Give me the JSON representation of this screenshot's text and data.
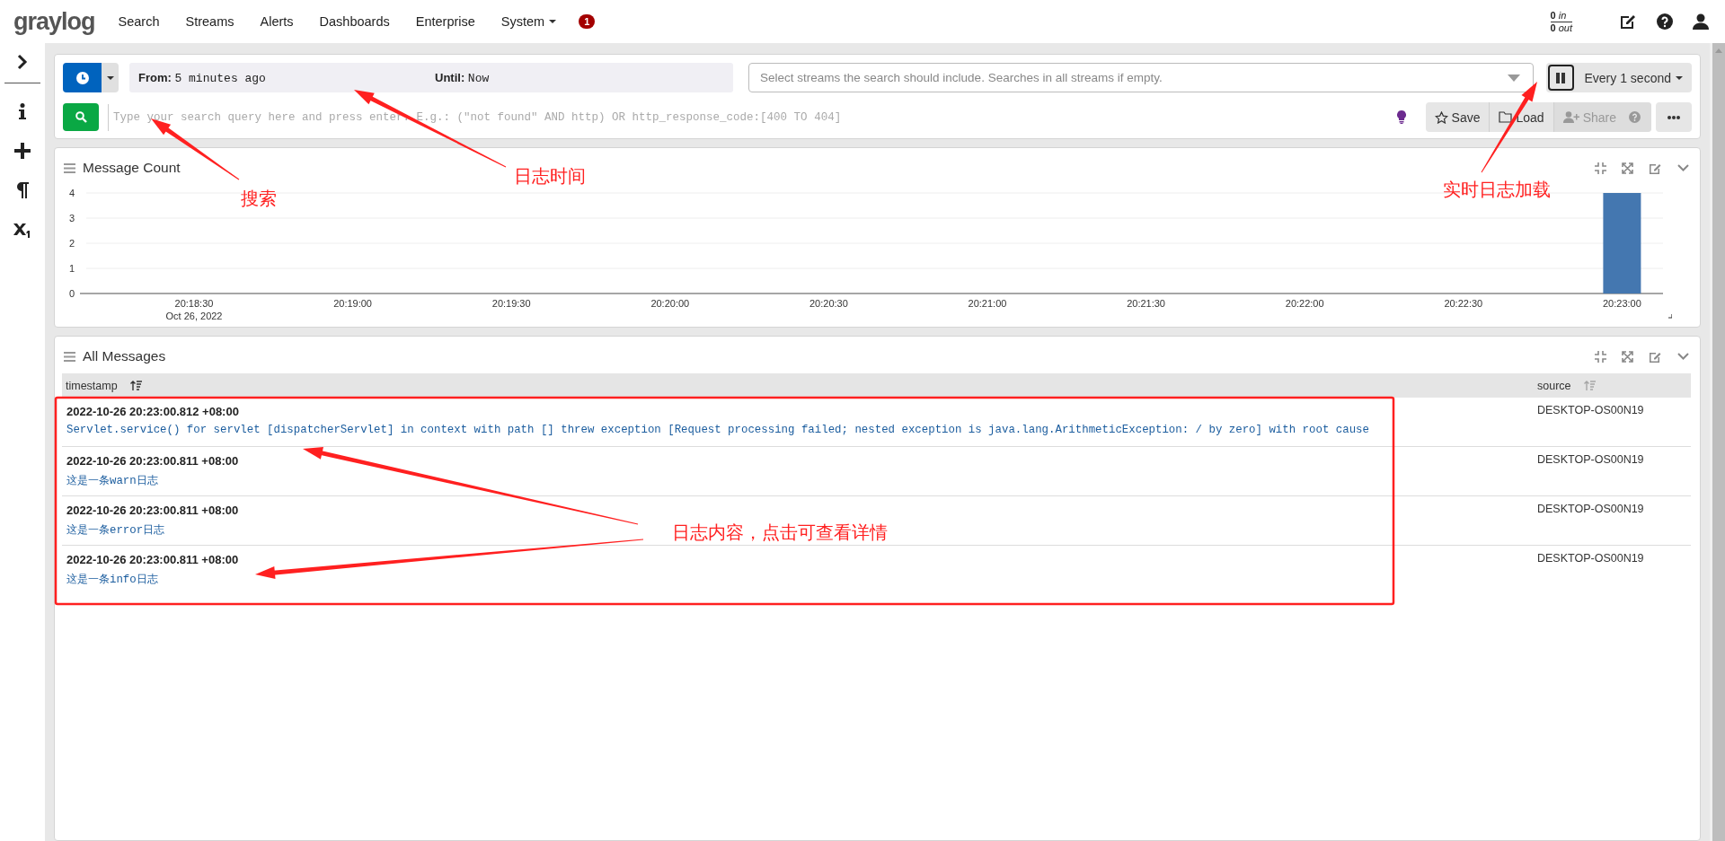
{
  "nav": {
    "logo": "graylog",
    "items": [
      {
        "label": "Search",
        "dropdown": false
      },
      {
        "label": "Streams",
        "dropdown": false
      },
      {
        "label": "Alerts",
        "dropdown": false
      },
      {
        "label": "Dashboards",
        "dropdown": false
      },
      {
        "label": "Enterprise",
        "dropdown": false
      },
      {
        "label": "System",
        "dropdown": true
      }
    ],
    "notification_count": "1",
    "throughput": [
      {
        "value": "0",
        "unit": "in"
      },
      {
        "value": "0",
        "unit": "out"
      }
    ]
  },
  "search_bar": {
    "from_label": "From:",
    "from_value": "5 minutes ago",
    "until_label": "Until:",
    "until_value": "Now",
    "streams_placeholder": "Select streams the search should include. Searches in all streams if empty.",
    "refresh": "Every 1 second",
    "query_placeholder": "Type your search query here and press enter. E.g.: (\"not found\" AND http) OR http_response_code:[400 TO 404]",
    "actions": [
      {
        "label": "Save",
        "disabled": false
      },
      {
        "label": "Load",
        "disabled": false
      },
      {
        "label": "Share",
        "disabled": true
      }
    ]
  },
  "message_count": {
    "title": "Message Count",
    "date_label": "Oct 26, 2022",
    "chart_data": {
      "type": "bar",
      "categories": [
        "20:18:30",
        "20:19:00",
        "20:19:30",
        "20:20:00",
        "20:20:30",
        "20:21:00",
        "20:21:30",
        "20:22:00",
        "20:22:30",
        "20:23:00"
      ],
      "values": [
        0,
        0,
        0,
        0,
        0,
        0,
        0,
        0,
        0,
        4
      ],
      "yticks": [
        0,
        1,
        2,
        3,
        4
      ],
      "ylim": [
        0,
        4
      ],
      "grid": true
    }
  },
  "all_messages": {
    "title": "All Messages",
    "columns": [
      "timestamp",
      "source"
    ],
    "rows": [
      {
        "timestamp": "2022-10-26 20:23:00.812 +08:00",
        "message": "Servlet.service() for servlet [dispatcherServlet] in context with path [] threw exception [Request processing failed; nested exception is java.lang.ArithmeticException: / by zero] with root cause",
        "source": "DESKTOP-OS00N19"
      },
      {
        "timestamp": "2022-10-26 20:23:00.811 +08:00",
        "message": "这是一条warn日志",
        "source": "DESKTOP-OS00N19"
      },
      {
        "timestamp": "2022-10-26 20:23:00.811 +08:00",
        "message": "这是一条error日志",
        "source": "DESKTOP-OS00N19"
      },
      {
        "timestamp": "2022-10-26 20:23:00.811 +08:00",
        "message": "这是一条info日志",
        "source": "DESKTOP-OS00N19"
      }
    ]
  },
  "annotations": [
    {
      "text": "搜索"
    },
    {
      "text": "日志时间"
    },
    {
      "text": "实时日志加载"
    },
    {
      "text": "日志内容，点击可查看详情"
    }
  ]
}
